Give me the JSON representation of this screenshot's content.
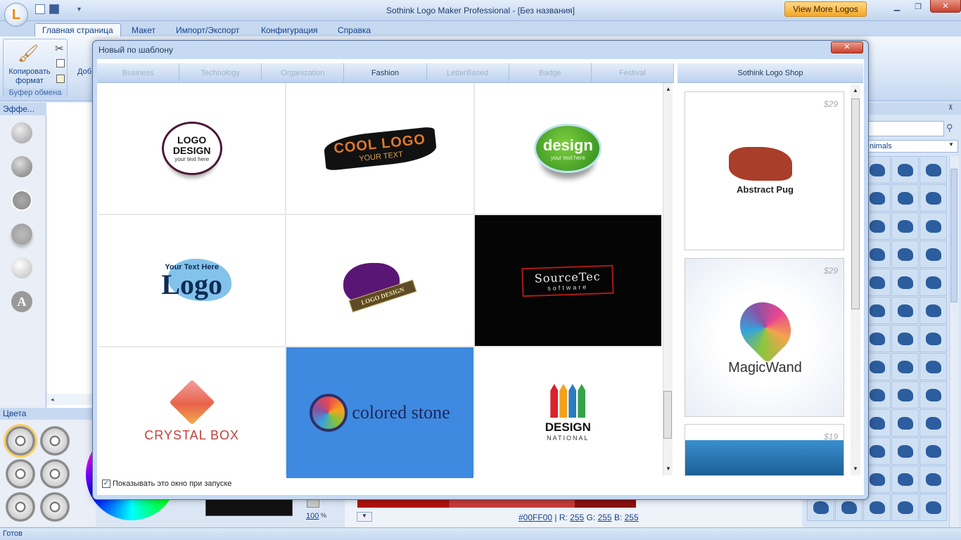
{
  "app": {
    "title": "Sothink Logo Maker Professional - [Без названия]",
    "view_more": "View More Logos"
  },
  "tabs": [
    "Главная страница",
    "Макет",
    "Импорт/Экспорт",
    "Конфигурация",
    "Справка"
  ],
  "ribbon": {
    "copy_format": "Копировать формат",
    "clipboard_group": "Буфер обмена",
    "add_label": "Доб"
  },
  "panels": {
    "effects": "Эффе...",
    "colors": "Цвета",
    "category": "nimals"
  },
  "dialog": {
    "title": "Новый по шаблону",
    "close": "✕",
    "categories": [
      "Business",
      "Technology",
      "Organization",
      "Fashion",
      "LetterBased",
      "Badge",
      "Festival"
    ],
    "active_category": "Fashion",
    "shop_tab": "Sothink Logo Shop",
    "templates": [
      {
        "line1": "LOGO",
        "line2": "DESIGN",
        "sub": "your text here"
      },
      {
        "line1": "COOL LOGO",
        "sub": "YOUR TEXT"
      },
      {
        "line1": "design",
        "sub": "your text here"
      },
      {
        "line1": "Your Text Here",
        "line2": "Logo"
      },
      {
        "line1": "LOGO DESIGN"
      },
      {
        "line1": "SourceTec",
        "sub": "software"
      },
      {
        "line1": "CRYSTAL BOX"
      },
      {
        "line1": "colored stone"
      },
      {
        "line1": "DESIGN",
        "sub": "NATIONAL"
      }
    ],
    "shop": [
      {
        "price": "$29",
        "name": "Abstract Pug"
      },
      {
        "price": "$29",
        "name": "MagicWand"
      },
      {
        "price": "$19"
      }
    ],
    "show_on_startup": "Показывать это окно при запуске"
  },
  "color_info": {
    "hex": "#00FF00",
    "r_label": "R:",
    "r": "255",
    "g_label": "G:",
    "g": "255",
    "b_label": "B:",
    "b": "255",
    "opacity": "100",
    "opacity_unit": "%"
  },
  "status": "Готов",
  "colors_map": {
    "accent": "#15428b",
    "ribbon": "#dbe6f5",
    "view_more": "#f5a623",
    "close_red": "#c9412b"
  }
}
